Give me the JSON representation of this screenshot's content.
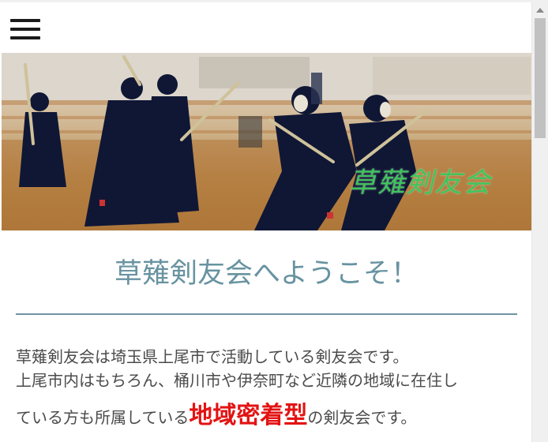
{
  "nav": {
    "menu_icon": "hamburger-menu-icon"
  },
  "hero": {
    "logo_text": "草薙剣友会",
    "logo_color": "#3ec55b"
  },
  "welcome": {
    "title": "草薙剣友会へようこそ！",
    "color": "#6893a1"
  },
  "intro": {
    "line1": "草薙剣友会は埼玉県上尾市で活動している剣友会です。",
    "line2": "上尾市内はもちろん、桶川市や伊奈町など近隣の地域に在住し",
    "line3_before": "ている方も所属している",
    "line3_emphasis": "地域密着型",
    "line3_after": "の剣友会です。",
    "emphasis_color": "#e31313"
  }
}
